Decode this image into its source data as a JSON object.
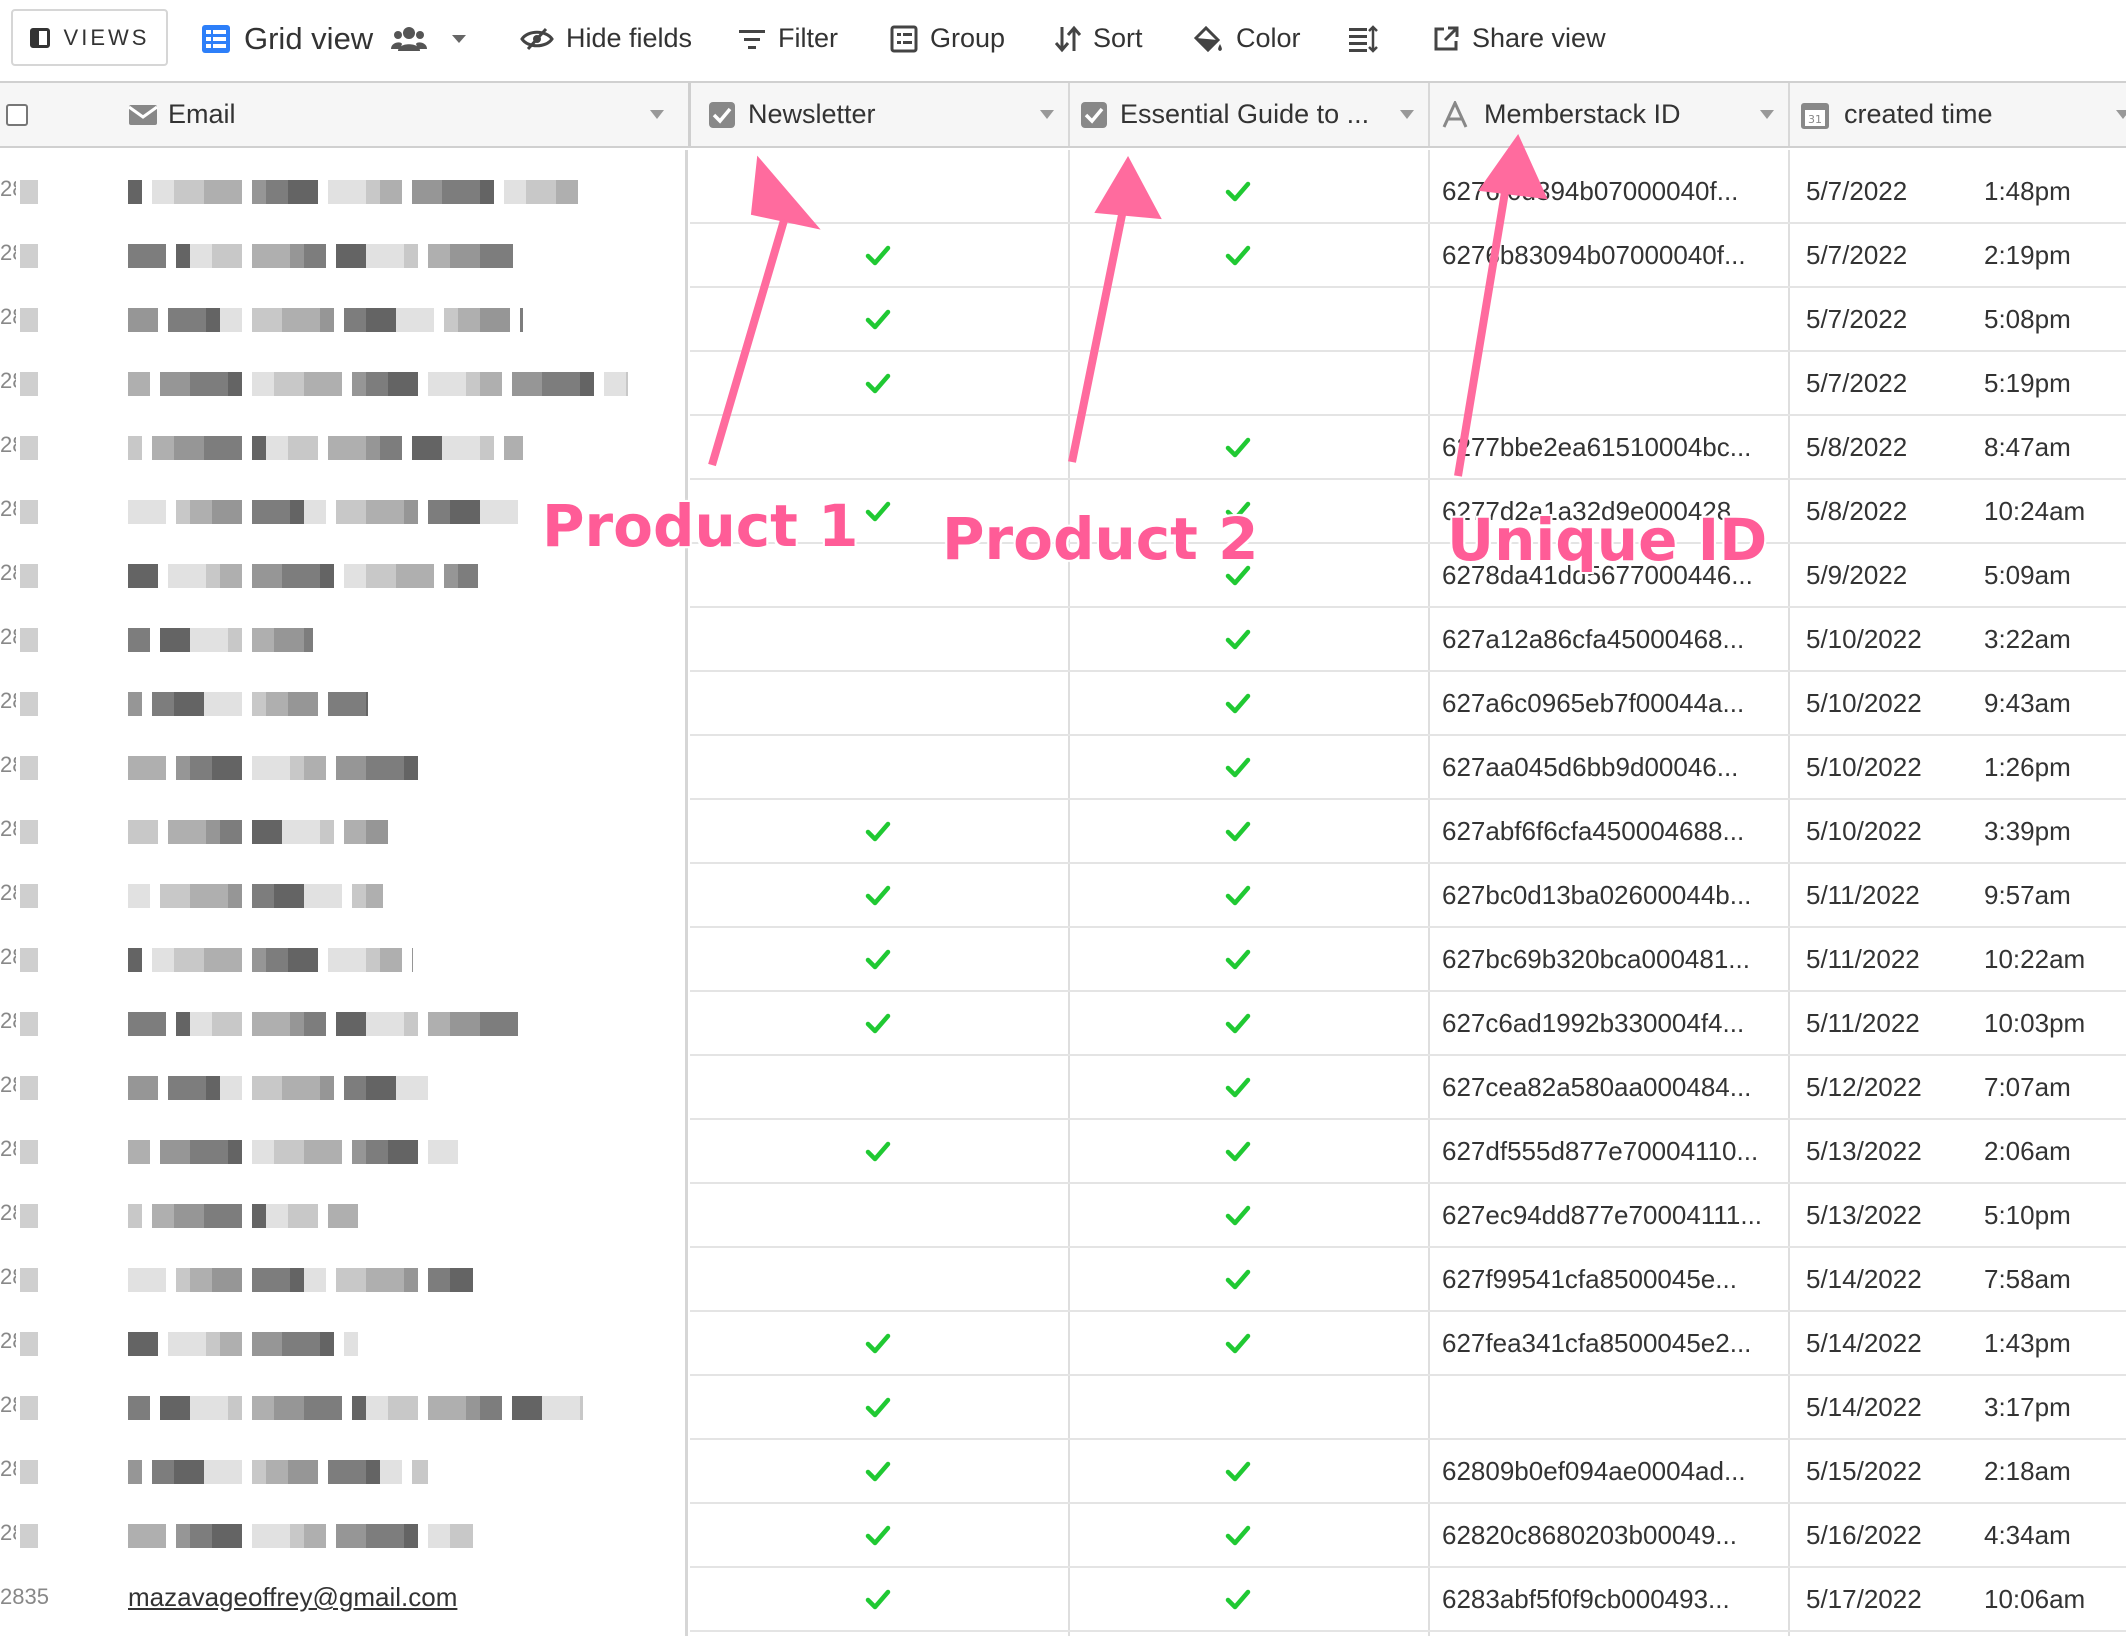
{
  "toolbar": {
    "views_label": "VIEWS",
    "grid_view_label": "Grid view",
    "hide_fields": "Hide fields",
    "filter": "Filter",
    "group": "Group",
    "sort": "Sort",
    "color": "Color",
    "share_view": "Share view"
  },
  "columns": {
    "email": "Email",
    "newsletter": "Newsletter",
    "essential_guide": "Essential Guide to ...",
    "memberstack_id": "Memberstack ID",
    "created_time": "created time"
  },
  "colors": {
    "accent": "#2d7ff9",
    "check": "#20c933",
    "annotation": "#ff5c97"
  },
  "annotations": {
    "product1": "Product 1",
    "product2": "Product 2",
    "unique_id": "Unique ID"
  },
  "last_email": "mazavageoffrey@gmail.com",
  "last_rownum": "2835",
  "rownum_prefix": "28",
  "rows": [
    {
      "newsletter": false,
      "guide": true,
      "id": "6276f0d394b07000040f...",
      "date": "5/7/2022",
      "time": "1:48pm"
    },
    {
      "newsletter": true,
      "guide": true,
      "id": "6276b83094b07000040f...",
      "date": "5/7/2022",
      "time": "2:19pm"
    },
    {
      "newsletter": true,
      "guide": false,
      "id": "",
      "date": "5/7/2022",
      "time": "5:08pm"
    },
    {
      "newsletter": true,
      "guide": false,
      "id": "",
      "date": "5/7/2022",
      "time": "5:19pm"
    },
    {
      "newsletter": false,
      "guide": true,
      "id": "6277bbe2ea61510004bc...",
      "date": "5/8/2022",
      "time": "8:47am"
    },
    {
      "newsletter": true,
      "guide": true,
      "id": "6277d2a1a32d9e000428...",
      "date": "5/8/2022",
      "time": "10:24am"
    },
    {
      "newsletter": false,
      "guide": true,
      "id": "6278da41dd5677000446...",
      "date": "5/9/2022",
      "time": "5:09am"
    },
    {
      "newsletter": false,
      "guide": true,
      "id": "627a12a86cfa45000468...",
      "date": "5/10/2022",
      "time": "3:22am"
    },
    {
      "newsletter": false,
      "guide": true,
      "id": "627a6c0965eb7f00044a...",
      "date": "5/10/2022",
      "time": "9:43am"
    },
    {
      "newsletter": false,
      "guide": true,
      "id": "627aa045d6bb9d00046...",
      "date": "5/10/2022",
      "time": "1:26pm"
    },
    {
      "newsletter": true,
      "guide": true,
      "id": "627abf6f6cfa450004688...",
      "date": "5/10/2022",
      "time": "3:39pm"
    },
    {
      "newsletter": true,
      "guide": true,
      "id": "627bc0d13ba02600044b...",
      "date": "5/11/2022",
      "time": "9:57am"
    },
    {
      "newsletter": true,
      "guide": true,
      "id": "627bc69b320bca000481...",
      "date": "5/11/2022",
      "time": "10:22am"
    },
    {
      "newsletter": true,
      "guide": true,
      "id": "627c6ad1992b330004f4...",
      "date": "5/11/2022",
      "time": "10:03pm"
    },
    {
      "newsletter": false,
      "guide": true,
      "id": "627cea82a580aa000484...",
      "date": "5/12/2022",
      "time": "7:07am"
    },
    {
      "newsletter": true,
      "guide": true,
      "id": "627df555d877e70004110...",
      "date": "5/13/2022",
      "time": "2:06am"
    },
    {
      "newsletter": false,
      "guide": true,
      "id": "627ec94dd877e70004111...",
      "date": "5/13/2022",
      "time": "5:10pm"
    },
    {
      "newsletter": false,
      "guide": true,
      "id": "627f99541cfa8500045e...",
      "date": "5/14/2022",
      "time": "7:58am"
    },
    {
      "newsletter": true,
      "guide": true,
      "id": "627fea341cfa8500045e2...",
      "date": "5/14/2022",
      "time": "1:43pm"
    },
    {
      "newsletter": true,
      "guide": false,
      "id": "",
      "date": "5/14/2022",
      "time": "3:17pm"
    },
    {
      "newsletter": true,
      "guide": true,
      "id": "62809b0ef094ae0004ad...",
      "date": "5/15/2022",
      "time": "2:18am"
    },
    {
      "newsletter": true,
      "guide": true,
      "id": "62820c8680203b00049...",
      "date": "5/16/2022",
      "time": "4:34am"
    },
    {
      "newsletter": true,
      "guide": true,
      "id": "6283abf5f0f9cb000493...",
      "date": "5/17/2022",
      "time": "10:06am"
    }
  ]
}
